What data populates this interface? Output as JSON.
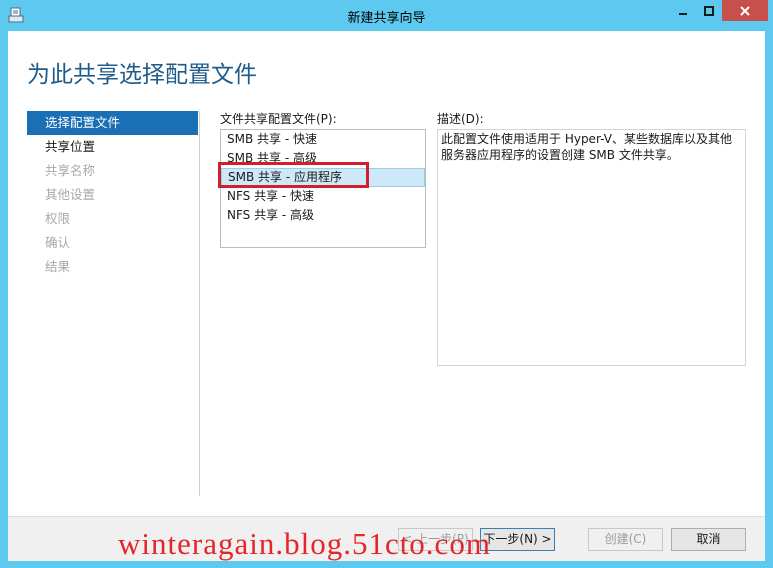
{
  "window": {
    "title": "新建共享向导",
    "colors": {
      "chrome": "#5ec9ef",
      "close": "#c7504a",
      "accent": "#1b6fb4",
      "heading": "#1f5c8b",
      "highlight": "#d21f2c"
    }
  },
  "header": {
    "title": "为此共享选择配置文件"
  },
  "nav": {
    "items": [
      {
        "label": "选择配置文件",
        "state": "active"
      },
      {
        "label": "共享位置",
        "state": "enabled"
      },
      {
        "label": "共享名称",
        "state": "disabled"
      },
      {
        "label": "其他设置",
        "state": "disabled"
      },
      {
        "label": "权限",
        "state": "disabled"
      },
      {
        "label": "确认",
        "state": "disabled"
      },
      {
        "label": "结果",
        "state": "disabled"
      }
    ]
  },
  "profiles": {
    "label": "文件共享配置文件(P):",
    "items": [
      {
        "label": "SMB 共享 - 快速",
        "selected": false
      },
      {
        "label": "SMB 共享 - 高级",
        "selected": false
      },
      {
        "label": "SMB 共享 - 应用程序",
        "selected": true
      },
      {
        "label": "NFS 共享 - 快速",
        "selected": false
      },
      {
        "label": "NFS 共享 - 高级",
        "selected": false
      }
    ]
  },
  "description": {
    "label": "描述(D):",
    "text": "此配置文件使用适用于 Hyper-V、某些数据库以及其他服务器应用程序的设置创建 SMB 文件共享。"
  },
  "footer": {
    "prev_label": "< 上一步(P)",
    "next_label": "下一步(N) >",
    "create_label": "创建(C)",
    "cancel_label": "取消"
  },
  "watermark": {
    "text": "winteragain.blog.51cto.com"
  }
}
